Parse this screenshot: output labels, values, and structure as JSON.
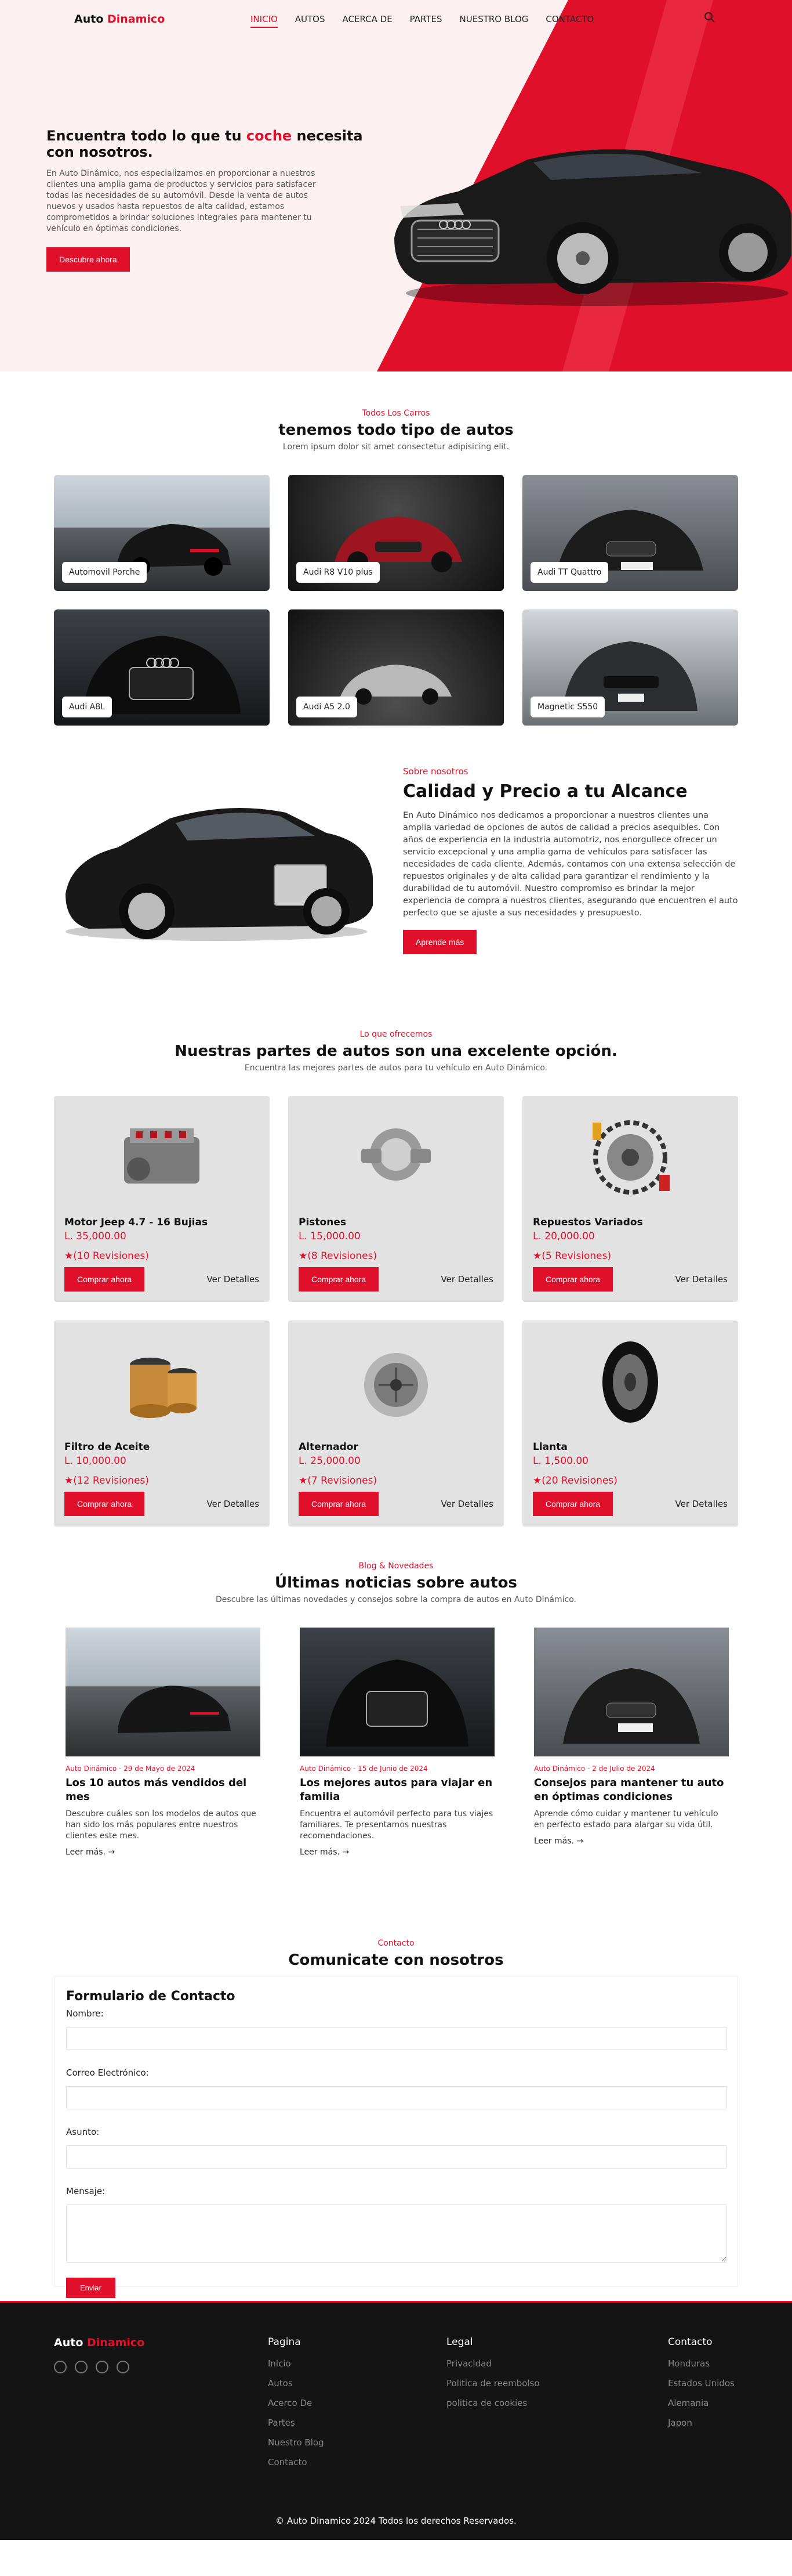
{
  "nav": {
    "logo_a": "Auto ",
    "logo_b": "Dinamico",
    "items": [
      "INICIO",
      "AUTOS",
      "ACERCA DE",
      "PARTES",
      "NUESTRO BLOG",
      "CONTACTO"
    ]
  },
  "hero": {
    "title_a": "Encuentra todo lo que tu ",
    "title_b": "coche",
    "title_c": " necesita con nosotros.",
    "text": "En Auto Dinámico, nos especializamos en proporcionar a nuestros clientes una amplia gama de productos y servicios para satisfacer todas las necesidades de su automóvil. Desde la venta de autos nuevos y usados hasta repuestos de alta calidad, estamos comprometidos a brindar soluciones integrales para mantener tu vehículo en óptimas condiciones.",
    "button": "Descubre ahora"
  },
  "cars": {
    "eyebrow": "Todos Los Carros",
    "title": "tenemos todo tipo de autos",
    "sub": "Lorem ipsum dolor sit amet consectetur adipisicing elit.",
    "items": [
      "Automovil Porche",
      "Audi R8 V10 plus",
      "Audi TT Quattro",
      "Audi A8L",
      "Audi A5 2.0",
      "Magnetic S550"
    ]
  },
  "about": {
    "eyebrow": "Sobre nosotros",
    "title": "Calidad y Precio a tu Alcance",
    "text": "En Auto Dinámico nos dedicamos a proporcionar a nuestros clientes una amplia variedad de opciones de autos de calidad a precios asequibles. Con años de experiencia en la industria automotriz, nos enorgullece ofrecer un servicio excepcional y una amplia gama de vehículos para satisfacer las necesidades de cada cliente. Además, contamos con una extensa selección de repuestos originales y de alta calidad para garantizar el rendimiento y la durabilidad de tu automóvil. Nuestro compromiso es brindar la mejor experiencia de compra a nuestros clientes, asegurando que encuentren el auto perfecto que se ajuste a sus necesidades y presupuesto.",
    "button": "Aprende más"
  },
  "parts": {
    "eyebrow": "Lo que ofrecemos",
    "title": "Nuestras partes de autos son una excelente opción.",
    "sub": "Encuentra las mejores partes de autos para tu vehículo en Auto Dinámico.",
    "buy_label": "Comprar ahora",
    "details_label": "Ver Detalles",
    "items": [
      {
        "name": "Motor Jeep 4.7 - 16 Bujias",
        "price": "L. 35,000.00",
        "reviews": "★(10 Revisiones)",
        "icon": "engine-icon"
      },
      {
        "name": "Pistones",
        "price": "L. 15,000.00",
        "reviews": "★(8 Revisiones)",
        "icon": "piston-icon"
      },
      {
        "name": "Repuestos Variados",
        "price": "L. 20,000.00",
        "reviews": "★(5 Revisiones)",
        "icon": "parts-icon"
      },
      {
        "name": "Filtro de Aceite",
        "price": "L. 10,000.00",
        "reviews": "★(12 Revisiones)",
        "icon": "oil-filter-icon"
      },
      {
        "name": "Alternador",
        "price": "L. 25,000.00",
        "reviews": "★(7 Revisiones)",
        "icon": "alternator-icon"
      },
      {
        "name": "Llanta",
        "price": "L. 1,500.00",
        "reviews": "★(20 Revisiones)",
        "icon": "tire-icon"
      }
    ]
  },
  "blog": {
    "eyebrow": "Blog & Novedades",
    "title": "Últimas noticias sobre autos",
    "sub": "Descubre las últimas novedades y consejos sobre la compra de autos en Auto Dinámico.",
    "more_label": "Leer más.",
    "posts": [
      {
        "meta": "Auto Dinámico - 29 de Mayo de 2024",
        "title": "Los 10 autos más vendidos del mes",
        "text": "Descubre cuáles son los modelos de autos que han sido los más populares entre nuestros clientes este mes."
      },
      {
        "meta": "Auto Dinámico - 15 de Junio de 2024",
        "title": "Los mejores autos para viajar en familia",
        "text": "Encuentra el automóvil perfecto para tus viajes familiares. Te presentamos nuestras recomendaciones."
      },
      {
        "meta": "Auto Dinámico - 2 de Julio de 2024",
        "title": "Consejos para mantener tu auto en óptimas condiciones",
        "text": "Aprende cómo cuidar y mantener tu vehículo en perfecto estado para alargar su vida útil."
      }
    ]
  },
  "contact": {
    "eyebrow": "Contacto",
    "title": "Comunicate con nosotros",
    "form_title": "Formulario de Contacto",
    "labels": [
      "Nombre:",
      "Correo Electrónico:",
      "Asunto:",
      "Mensaje:"
    ],
    "button": "Enviar"
  },
  "footer": {
    "logo_a": "Auto ",
    "logo_b": "Dinamico",
    "cols": [
      {
        "title": "Pagina",
        "items": [
          "Inicio",
          "Autos",
          "Acerco De",
          "Partes",
          "Nuestro Blog",
          "Contacto"
        ]
      },
      {
        "title": "Legal",
        "items": [
          "Privacidad",
          "Politica de reembolso",
          "politica de cookies"
        ]
      },
      {
        "title": "Contacto",
        "items": [
          "Honduras",
          "Estados Unidos",
          "Alemania",
          "Japon"
        ]
      }
    ],
    "social": [
      "facebook-icon",
      "twitter-icon",
      "instagram-icon",
      "whatsapp-icon"
    ],
    "copy": "© Auto Dinamico 2024 Todos los derechos Reservados."
  },
  "colors": {
    "accent": "#e0102a",
    "hero_bg": "#fdf0f0",
    "footer_bg": "#141414",
    "card_bg": "#e2e2e2"
  }
}
